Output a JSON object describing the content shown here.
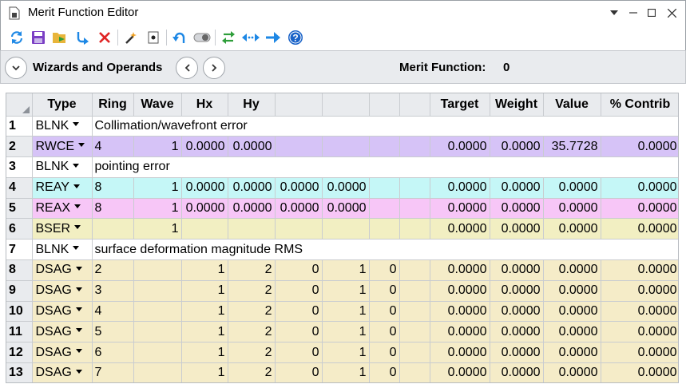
{
  "window": {
    "title": "Merit Function Editor",
    "icon": "document-icon",
    "controls": [
      "dropdown-arrow-icon",
      "minimize-icon",
      "maximize-icon",
      "close-icon"
    ]
  },
  "toolbar": {
    "icons": [
      "refresh-icon",
      "save-icon",
      "open-icon",
      "insert-icon",
      "delete-icon",
      "wand-icon",
      "target-icon",
      "undo-icon",
      "toggle-icon",
      "swap-icon",
      "expand-icon",
      "arrow-right-icon",
      "help-icon"
    ]
  },
  "wizard_bar": {
    "label": "Wizards and Operands",
    "merit_label": "Merit Function:",
    "merit_value": "0"
  },
  "grid": {
    "headers": [
      "Type",
      "Ring",
      "Wave",
      "Hx",
      "Hy",
      "",
      "",
      "",
      "",
      "Target",
      "Weight",
      "Value",
      "% Contrib"
    ],
    "rows": [
      {
        "num": "1",
        "type": "BLNK",
        "comment": "Collimation/wavefront error"
      },
      {
        "num": "2",
        "type": "RWCE",
        "cells": [
          "4",
          "1",
          "0.0000",
          "0.0000",
          "",
          "",
          "",
          "",
          "0.0000",
          "0.0000",
          "35.7728",
          "0.0000"
        ]
      },
      {
        "num": "3",
        "type": "BLNK",
        "comment": "pointing error"
      },
      {
        "num": "4",
        "type": "REAY",
        "cells": [
          "8",
          "1",
          "0.0000",
          "0.0000",
          "0.0000",
          "0.0000",
          "",
          "",
          "0.0000",
          "0.0000",
          "0.0000",
          "0.0000"
        ]
      },
      {
        "num": "5",
        "type": "REAX",
        "cells": [
          "8",
          "1",
          "0.0000",
          "0.0000",
          "0.0000",
          "0.0000",
          "",
          "",
          "0.0000",
          "0.0000",
          "0.0000",
          "0.0000"
        ]
      },
      {
        "num": "6",
        "type": "BSER",
        "cells": [
          "",
          "1",
          "",
          "",
          "",
          "",
          "",
          "",
          "0.0000",
          "0.0000",
          "0.0000",
          "0.0000"
        ]
      },
      {
        "num": "7",
        "type": "BLNK",
        "comment": "surface deformation magnitude RMS"
      },
      {
        "num": "8",
        "type": "DSAG",
        "cells": [
          "2",
          "",
          "1",
          "2",
          "0",
          "1",
          "0",
          "",
          "0.0000",
          "0.0000",
          "0.0000",
          "0.0000"
        ]
      },
      {
        "num": "9",
        "type": "DSAG",
        "cells": [
          "3",
          "",
          "1",
          "2",
          "0",
          "1",
          "0",
          "",
          "0.0000",
          "0.0000",
          "0.0000",
          "0.0000"
        ]
      },
      {
        "num": "10",
        "type": "DSAG",
        "cells": [
          "4",
          "",
          "1",
          "2",
          "0",
          "1",
          "0",
          "",
          "0.0000",
          "0.0000",
          "0.0000",
          "0.0000"
        ]
      },
      {
        "num": "11",
        "type": "DSAG",
        "cells": [
          "5",
          "",
          "1",
          "2",
          "0",
          "1",
          "0",
          "",
          "0.0000",
          "0.0000",
          "0.0000",
          "0.0000"
        ]
      },
      {
        "num": "12",
        "type": "DSAG",
        "cells": [
          "6",
          "",
          "1",
          "2",
          "0",
          "1",
          "0",
          "",
          "0.0000",
          "0.0000",
          "0.0000",
          "0.0000"
        ]
      },
      {
        "num": "13",
        "type": "DSAG",
        "cells": [
          "7",
          "",
          "1",
          "2",
          "0",
          "1",
          "0",
          "",
          "0.0000",
          "0.0000",
          "0.0000",
          "0.0000"
        ]
      }
    ]
  },
  "colors": {
    "RWCE": "#d6c3f7",
    "REAY": "#c5f7f7",
    "REAX": "#f7c6f7",
    "BSER": "#f2efc2",
    "DSAG": "#f5ecc8",
    "accent": "#1e6fd9"
  }
}
